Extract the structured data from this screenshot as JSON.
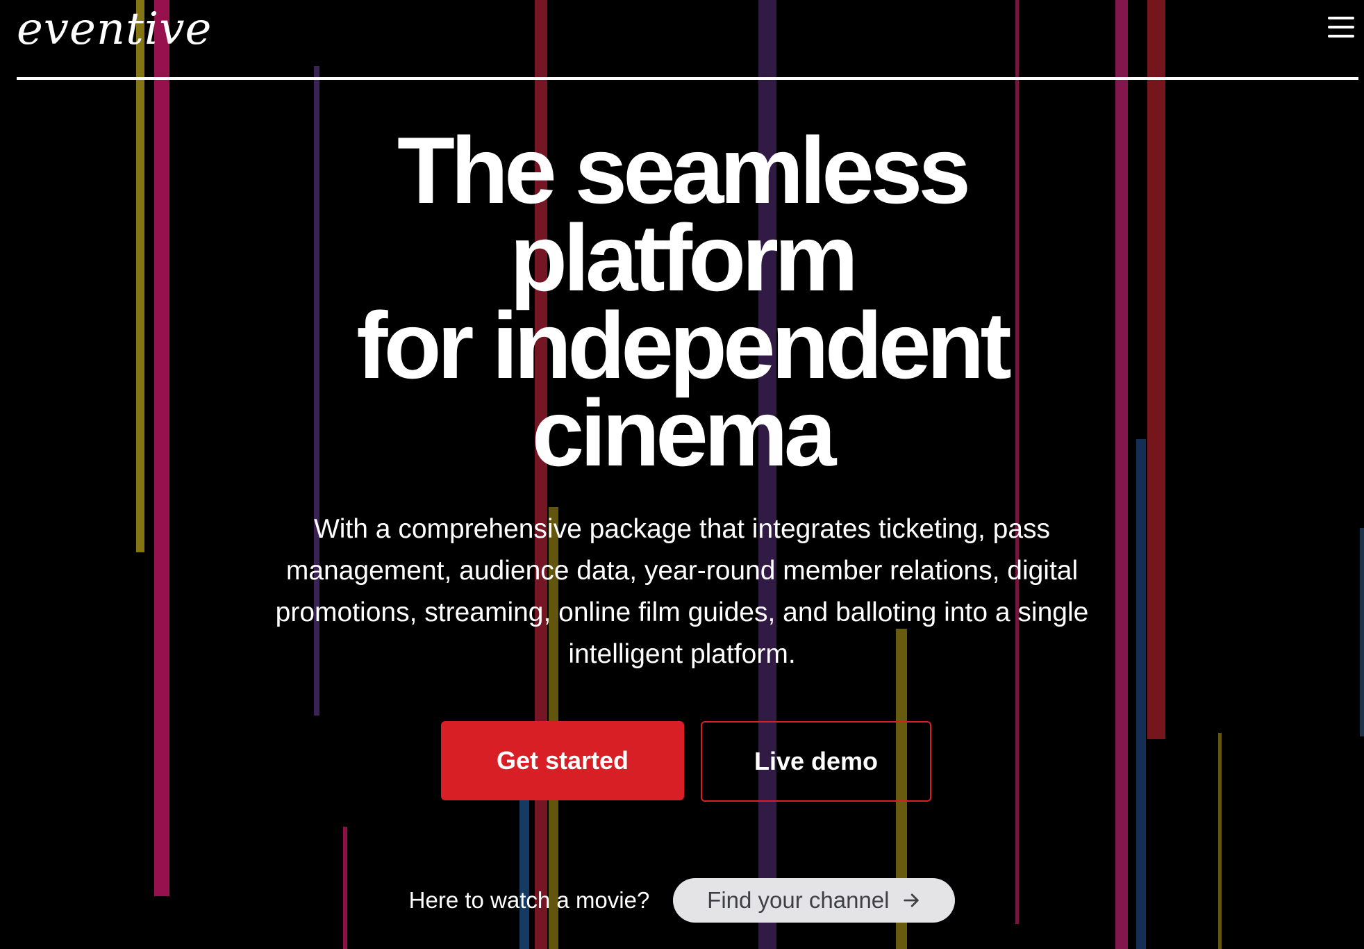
{
  "header": {
    "logo_text": "eventive",
    "menu_icon": "hamburger-menu-icon"
  },
  "hero": {
    "headline_lines": [
      "The seamless",
      "platform",
      "for independent",
      "cinema"
    ],
    "subtext": "With a comprehensive package that integrates ticketing, pass management, audience data, year-round member relations, digital promotions, streaming, online film guides, and balloting into a single intelligent platform.",
    "primary_cta": "Get started",
    "secondary_cta": "Live demo"
  },
  "watch": {
    "prompt": "Here to watch a movie?",
    "button_label": "Find your channel",
    "button_icon": "arrow-right-icon"
  },
  "colors": {
    "background": "#000000",
    "accent_red": "#d81f26",
    "pill_bg": "#e4e4e7",
    "pill_text": "#3f3f46"
  }
}
